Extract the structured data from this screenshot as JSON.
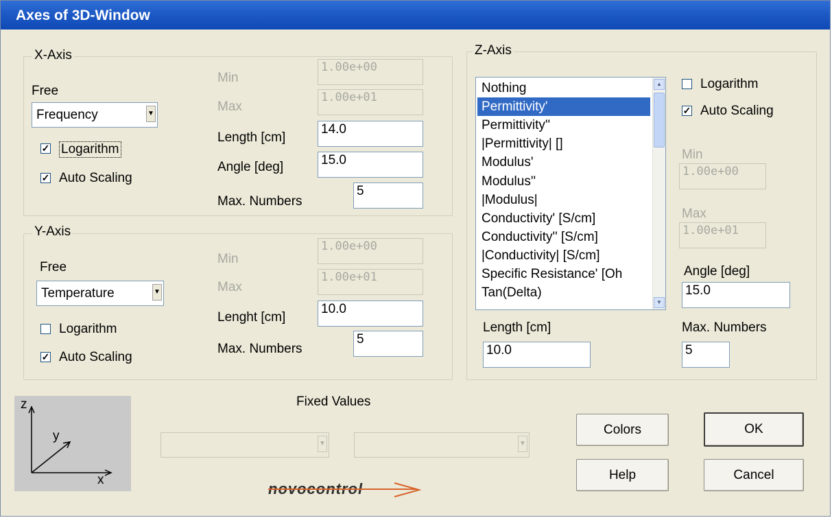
{
  "window": {
    "title": "Axes of 3D-Window"
  },
  "x_axis": {
    "group_label": "X-Axis",
    "type_label": "Free",
    "combo_value": "Frequency",
    "logarithm": {
      "label": "Logarithm",
      "checked": true
    },
    "auto_scaling": {
      "label": "Auto Scaling",
      "checked": true
    },
    "min_label": "Min",
    "min_value": "1.00e+00",
    "max_label": "Max",
    "max_value": "1.00e+01",
    "length_label": "Length [cm]",
    "length_value": "14.0",
    "angle_label": "Angle [deg]",
    "angle_value": "15.0",
    "max_numbers_label": "Max. Numbers",
    "max_numbers_value": "5"
  },
  "y_axis": {
    "group_label": "Y-Axis",
    "type_label": "Free",
    "combo_value": "Temperature",
    "logarithm": {
      "label": "Logarithm",
      "checked": false
    },
    "auto_scaling": {
      "label": "Auto Scaling",
      "checked": true
    },
    "min_label": "Min",
    "min_value": "1.00e+00",
    "max_label": "Max",
    "max_value": "1.00e+01",
    "length_label": "Lenght [cm]",
    "length_value": "10.0",
    "max_numbers_label": "Max. Numbers",
    "max_numbers_value": "5"
  },
  "z_axis": {
    "group_label": "Z-Axis",
    "list_items": [
      "Nothing",
      "Permittivity'",
      "Permittivity''",
      "|Permittivity| []",
      "Modulus'",
      "Modulus''",
      "|Modulus|",
      "Conductivity' [S/cm]",
      "Conductivity'' [S/cm]",
      "|Conductivity| [S/cm]",
      "Specific Resistance' [Oh",
      "Tan(Delta)"
    ],
    "selected_item": "Permittivity'",
    "logarithm": {
      "label": "Logarithm",
      "checked": false
    },
    "auto_scaling": {
      "label": "Auto Scaling",
      "checked": true
    },
    "min_label": "Min",
    "min_value": "1.00e+00",
    "max_label": "Max",
    "max_value": "1.00e+01",
    "angle_label": "Angle [deg]",
    "angle_value": "15.0",
    "length_label": "Length [cm]",
    "length_value": "10.0",
    "max_numbers_label": "Max. Numbers",
    "max_numbers_value": "5"
  },
  "fixed_values": {
    "label": "Fixed Values",
    "combo1_value": "",
    "combo2_value": ""
  },
  "axes_icon": {
    "z": "z",
    "y": "y",
    "x": "x"
  },
  "buttons": {
    "colors": "Colors",
    "ok": "OK",
    "help": "Help",
    "cancel": "Cancel"
  },
  "logo_text": "novocontrol",
  "colors": {
    "titlebar": "#0f49b5",
    "selection": "#316ac5",
    "window_bg": "#ece9d8"
  }
}
